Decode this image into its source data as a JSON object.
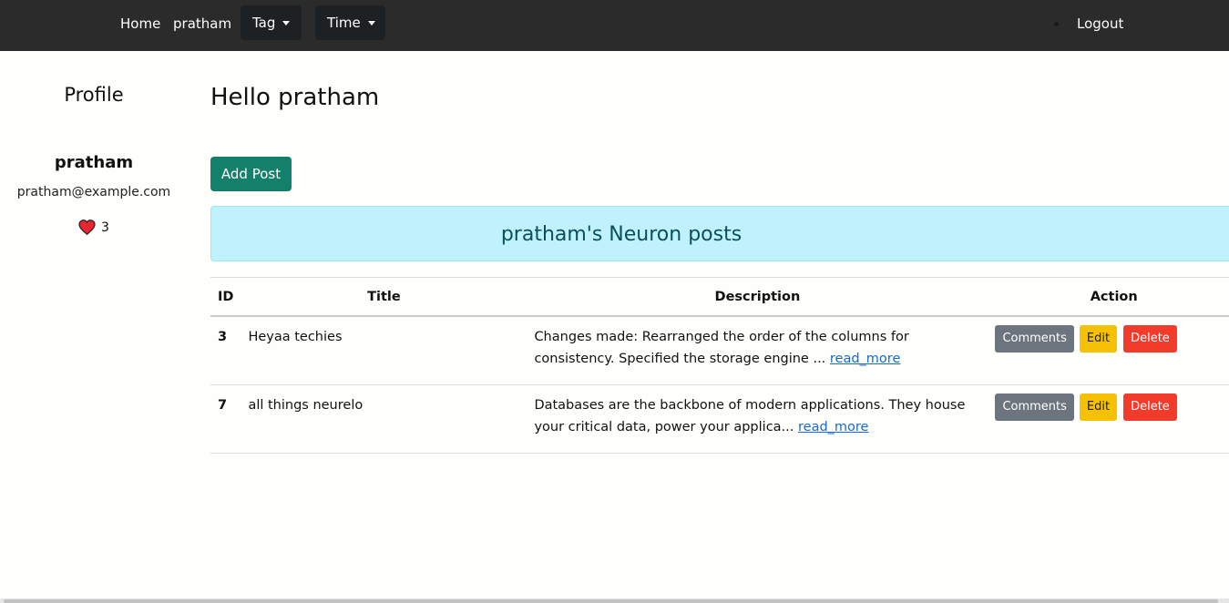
{
  "nav": {
    "home": "Home",
    "user": "pratham",
    "tag": "Tag",
    "time": "Time",
    "logout": "Logout"
  },
  "sidebar": {
    "title": "Profile",
    "name": "pratham",
    "email": "pratham@example.com",
    "likes": "3",
    "like_icon": "heart-icon"
  },
  "main": {
    "greeting": "Hello pratham",
    "add_post": "Add Post",
    "banner": "pratham's Neuron posts",
    "columns": [
      "ID",
      "Title",
      "Description",
      "Action"
    ],
    "rows": [
      {
        "id": "3",
        "title": "Heyaa techies",
        "description": "Changes made: Rearranged the order of the columns for consistency. Specified the storage engine ...",
        "read_more": "read_more"
      },
      {
        "id": "7",
        "title": "all things neurelo",
        "description": "Databases are the backbone of modern applications. They house your critical data, power your applica...",
        "read_more": "read_more"
      }
    ],
    "actions": {
      "comments": "Comments",
      "edit": "Edit",
      "delete": "Delete"
    }
  },
  "colors": {
    "navbar": "#2b2b2b",
    "primary_button": "#12806a",
    "banner_bg": "#bff2fc",
    "edit": "#f5c102",
    "delete": "#f23b2b",
    "comments": "#6c757d"
  }
}
